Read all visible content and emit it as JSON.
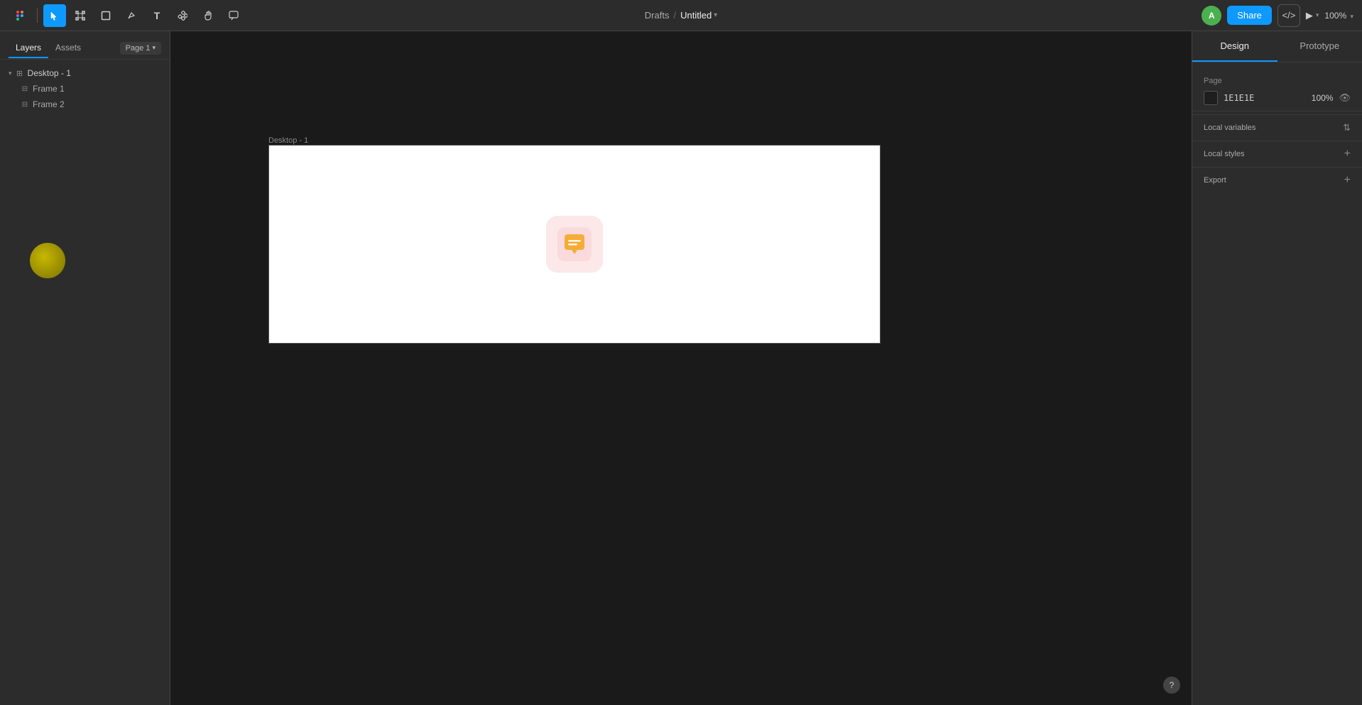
{
  "app": {
    "name": "Figma",
    "logo": "◈"
  },
  "topbar": {
    "breadcrumb_drafts": "Drafts",
    "breadcrumb_sep": "/",
    "file_name": "Untitled",
    "dropdown_arrow": "▾",
    "share_label": "Share",
    "code_label": "</>",
    "play_label": "▶",
    "zoom_label": "100%",
    "zoom_arrow": "▾",
    "avatar_initial": "A"
  },
  "left_panel": {
    "tab_layers": "Layers",
    "tab_assets": "Assets",
    "page_label": "Page 1",
    "page_arrow": "▾",
    "desktop_group": "Desktop - 1",
    "frame1": "Frame 1",
    "frame2": "Frame 2"
  },
  "canvas": {
    "frame_label": "Desktop - 1"
  },
  "right_panel": {
    "tab_design": "Design",
    "tab_prototype": "Prototype",
    "section_page": "Page",
    "color_hex": "1E1E1E",
    "opacity_pct": "100%",
    "section_local_variables": "Local variables",
    "section_local_styles": "Local styles",
    "section_export": "Export",
    "add_icon": "+",
    "sort_icon": "⇅"
  },
  "help": {
    "label": "?"
  }
}
